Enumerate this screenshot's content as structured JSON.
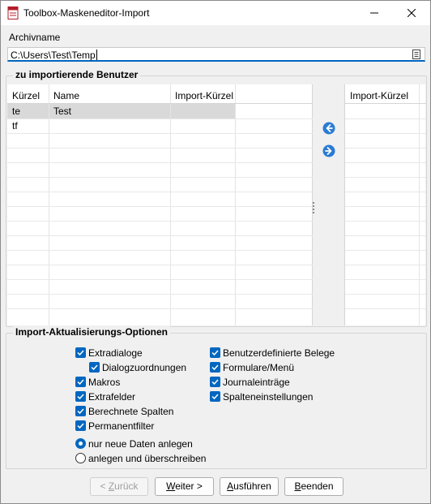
{
  "window": {
    "title": "Toolbox-Maskeneditor-Import"
  },
  "archiv": {
    "label": "Archivname",
    "value": "C:\\Users\\Test\\Temp"
  },
  "users": {
    "group_title": "zu importierende Benutzer",
    "columns": [
      "Kürzel",
      "Name",
      "Import-Kürzel"
    ],
    "rows": [
      {
        "kuerzel": "te",
        "name": "Test",
        "import": ""
      },
      {
        "kuerzel": "tf",
        "name": "",
        "import": ""
      }
    ],
    "right_column": "Import-Kürzel"
  },
  "options": {
    "group_title": "Import-Aktualisierungs-Optionen",
    "left": [
      {
        "label": "Extradialoge",
        "checked": true
      },
      {
        "label": "Dialogzuordnungen",
        "checked": true
      },
      {
        "label": "Makros",
        "checked": true
      },
      {
        "label": "Extrafelder",
        "checked": true
      },
      {
        "label": "Berechnete Spalten",
        "checked": true
      },
      {
        "label": "Permanentfilter",
        "checked": true
      }
    ],
    "right": [
      {
        "label": "Benutzerdefinierte Belege",
        "checked": true
      },
      {
        "label": "Formulare/Menü",
        "checked": true
      },
      {
        "label": "Journaleinträge",
        "checked": true
      },
      {
        "label": "Spalteneinstellungen",
        "checked": true
      }
    ],
    "radios": [
      {
        "label": "nur neue Daten anlegen",
        "selected": true
      },
      {
        "label": "anlegen und überschreiben",
        "selected": false
      }
    ]
  },
  "buttons": {
    "back": {
      "accel": "< ",
      "underline": "Z",
      "rest": "urück"
    },
    "next": {
      "underline": "W",
      "rest": "eiter >"
    },
    "run": {
      "underline": "A",
      "rest": "usführen"
    },
    "end": {
      "underline": "B",
      "rest": "eenden"
    }
  },
  "colors": {
    "accent": "#0067c0",
    "selected_row": "#d9d9d9"
  }
}
